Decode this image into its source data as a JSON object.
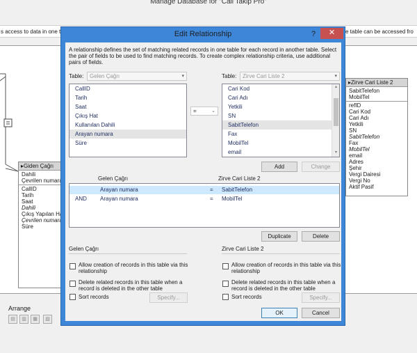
{
  "window": {
    "title": "Manage Database for \"Call Takip Pro\"",
    "info_left": "s access to data in one t",
    "info_right": "e table can be accessed fro"
  },
  "tables": {
    "geden": {
      "header": "Giden Çağrı",
      "top_fields": [
        "Dahili",
        "Çevrilen numara"
      ],
      "fields": [
        {
          "label": "CallID",
          "italic": false
        },
        {
          "label": "Tarih",
          "italic": false
        },
        {
          "label": "Saat",
          "italic": false
        },
        {
          "label": "Dahili",
          "italic": true
        },
        {
          "label": "Çıkış Yapılan Ha",
          "italic": false
        },
        {
          "label": "Çevrilen numara",
          "italic": true
        },
        {
          "label": "Süre",
          "italic": false
        }
      ]
    },
    "zirve": {
      "header": "Zirve Cari Liste 2",
      "top_fields": [
        "SabitTelefon",
        "MobilTel"
      ],
      "fields": [
        {
          "label": "refID",
          "italic": false
        },
        {
          "label": "Cari Kod",
          "italic": false
        },
        {
          "label": "Cari Adı",
          "italic": false
        },
        {
          "label": "Yetkili",
          "italic": false
        },
        {
          "label": "SN",
          "italic": false
        },
        {
          "label": "SabitTelefon",
          "italic": true
        },
        {
          "label": "Fax",
          "italic": false
        },
        {
          "label": "MobilTel",
          "italic": true
        },
        {
          "label": "email",
          "italic": false
        },
        {
          "label": "Adres",
          "italic": false
        },
        {
          "label": "Şehir",
          "italic": false
        },
        {
          "label": "Vergi Dairesi",
          "italic": false
        },
        {
          "label": "Vergi No",
          "italic": false
        },
        {
          "label": "Aktif Pasif",
          "italic": false
        }
      ]
    }
  },
  "arrange": {
    "label": "Arrange"
  },
  "dialog": {
    "title": "Edit Relationship",
    "help": "?",
    "close": "✕",
    "description": "A relationship defines the set of matching related records in one table for each record in another table. Select the pair of fields to be used to find matching records. To create complex relationship criteria, use additional pairs of fields.",
    "left_table_label": "Table:",
    "left_table_value": "Gelen Çağrı",
    "right_table_label": "Table:",
    "right_table_value": "Zirve Cari Liste 2",
    "left_fields": [
      "CallID",
      "Tarih",
      "Saat",
      "Çıkış Hat",
      "Kullanılan Dahili",
      "Arayan numara",
      "Süre"
    ],
    "left_selected_index": 5,
    "operator": "=",
    "right_fields": [
      "Cari Kod",
      "Cari Adı",
      "Yetkili",
      "SN",
      "SabitTelefon",
      "Fax",
      "MobilTel",
      "email"
    ],
    "right_selected_index": 4,
    "add_label": "Add",
    "change_label": "Change",
    "pairs_left_header": "Gelen Çağrı",
    "pairs_right_header": "Zirve Cari Liste 2",
    "pairs": [
      {
        "conj": "",
        "left": "Arayan numara",
        "op": "=",
        "right": "SabitTelefon",
        "selected": true
      },
      {
        "conj": "AND",
        "left": "Arayan numara",
        "op": "=",
        "right": "MobilTel",
        "selected": false
      }
    ],
    "duplicate_label": "Duplicate",
    "delete_label": "Delete",
    "left_options": {
      "title": "Gelen Çağrı",
      "allow": "Allow creation of records in this table via this relationship",
      "delete_related": "Delete related records in this table when a record is deleted in the other table",
      "sort": "Sort records",
      "specify": "Specify..."
    },
    "right_options": {
      "title": "Zirve Cari Liste 2",
      "allow": "Allow creation of records in this table via this relationship",
      "delete_related": "Delete related records in this table when a record is deleted in the other table",
      "sort": "Sort records",
      "specify": "Specify..."
    },
    "ok_label": "OK",
    "cancel_label": "Cancel"
  }
}
